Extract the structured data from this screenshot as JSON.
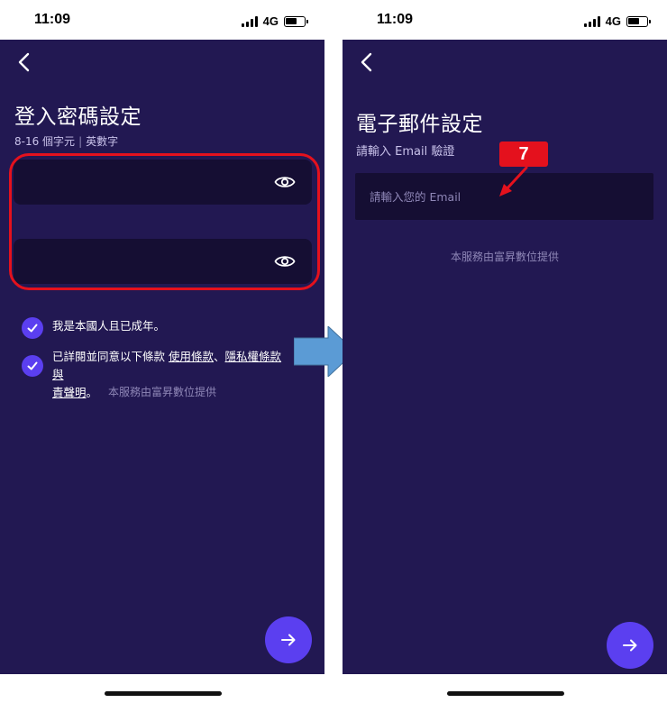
{
  "status_bar": {
    "time": "11:09",
    "network": "4G"
  },
  "left_screen": {
    "title": "登入密碼設定",
    "hint": {
      "length": "8-16 個字元",
      "separator": "|",
      "type": "英數字"
    },
    "password_field_1": {
      "value": ""
    },
    "password_field_2": {
      "value": ""
    },
    "checks": {
      "citizen": "我是本國人且已成年。",
      "terms_prefix": "已詳閱並同意以下條款",
      "terms_link": "使用條款",
      "terms_sep": "、",
      "privacy_link": "隱私權條款與",
      "disclaimer_link": "責聲明",
      "terms_end": "。"
    },
    "provider": "本服務由富昇數位提供"
  },
  "right_screen": {
    "title": "電子郵件設定",
    "hint": "請輸入 Email 驗證",
    "email_placeholder": "請輸入您的 Email",
    "email_value": "",
    "provider": "本服務由富昇數位提供"
  },
  "annotation": {
    "step_number": "7"
  },
  "icons": {
    "back": "chevron-left-icon",
    "eye": "eye-icon",
    "check": "checkmark-icon",
    "next": "arrow-right-icon",
    "flow": "flow-arrow-icon"
  },
  "colors": {
    "screen_bg": "#221852",
    "field_bg": "#150e33",
    "accent": "#5b3ff0",
    "highlight": "#e4111d",
    "flow_arrow": "#5b9bd5"
  }
}
